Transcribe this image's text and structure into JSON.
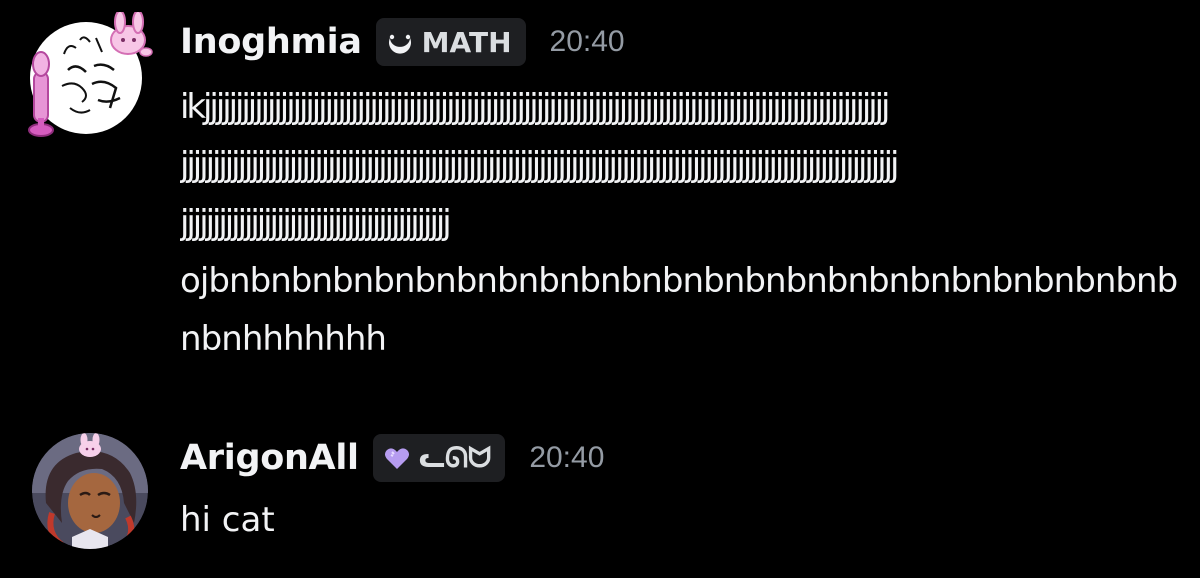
{
  "messages": [
    {
      "username": "Inoghmia",
      "tag": {
        "text": "MATH",
        "icon": "crescent-icon"
      },
      "timestamp": "20:40",
      "lines": [
        "ikjjjjjjjjjjjjjjjjjjjjjjjjjjjjjjjjjjjjjjjjjjjjjjjjjjjjjjjjjjjjjjjjjjjjjjjjjjjjjjjjjjjjjjjjjjjjjjjjjjjjjjjjjjj",
        "jjjjjjjjjjjjjjjjjjjjjjjjjjjjjjjjjjjjjjjjjjjjjjjjjjjjjjjjjjjjjjjjjjjjjjjjjjjjjjjjjjjjjjjjjjjjjjjjjjjjjjjjjjjjjjjj",
        "jjjjjjjjjjjjjjjjjjjjjjjjjjjjjjjjjjjjjjjjjj",
        "ojbnbnbnbnbnbnbnbnbnbnbnbnbnbnbnbnbnbnbnbnbnbnbnb",
        "nbnhhhhhhh"
      ]
    },
    {
      "username": "ArigonAll",
      "tag": {
        "text": "ᓚᘏᗢ",
        "icon": "heart-icon"
      },
      "timestamp": "20:40",
      "lines": [
        "hi cat"
      ]
    }
  ],
  "colors": {
    "background": "#000000",
    "text": "#f2f3f5",
    "timestamp": "#949ba4",
    "tag_background": "#1e1f22",
    "heart": "#b69cf0"
  }
}
